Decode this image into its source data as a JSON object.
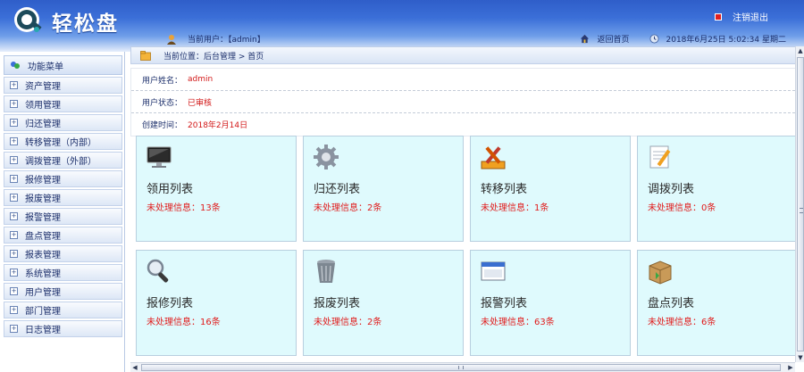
{
  "header": {
    "app_title": "轻松盘",
    "logout_label": "注销退出",
    "user_label": "当前用户：【admin】",
    "home_link": "返回首页",
    "datetime": "2018年6月25日  5:02:34 星期二"
  },
  "sidebar": {
    "title": "功能菜单",
    "items": [
      {
        "label": "资产管理"
      },
      {
        "label": "领用管理"
      },
      {
        "label": "归还管理"
      },
      {
        "label": "转移管理（内部）"
      },
      {
        "label": "调拨管理（外部）"
      },
      {
        "label": "报修管理"
      },
      {
        "label": "报废管理"
      },
      {
        "label": "报警管理"
      },
      {
        "label": "盘点管理"
      },
      {
        "label": "报表管理"
      },
      {
        "label": "系统管理"
      },
      {
        "label": "用户管理"
      },
      {
        "label": "部门管理"
      },
      {
        "label": "日志管理"
      }
    ]
  },
  "breadcrumb": {
    "text": "当前位置：后台管理 > 首页"
  },
  "info": {
    "name_label": "用户姓名：",
    "name_value": "admin",
    "status_label": "用户状态：",
    "status_value": "已审核",
    "time_label": "创建时间：",
    "time_value": "2018年2月14日"
  },
  "cards": [
    {
      "title": "领用列表",
      "stat": "未处理信息：13条",
      "icon": "monitor-icon"
    },
    {
      "title": "归还列表",
      "stat": "未处理信息：2条",
      "icon": "gear-icon"
    },
    {
      "title": "转移列表",
      "stat": "未处理信息：1条",
      "icon": "tools-icon"
    },
    {
      "title": "调拨列表",
      "stat": "未处理信息：0条",
      "icon": "notepad-icon"
    },
    {
      "title": "报修列表",
      "stat": "未处理信息：16条",
      "icon": "magnifier-icon"
    },
    {
      "title": "报废列表",
      "stat": "未处理信息：2条",
      "icon": "trash-icon"
    },
    {
      "title": "报警列表",
      "stat": "未处理信息：63条",
      "icon": "window-icon"
    },
    {
      "title": "盘点列表",
      "stat": "未处理信息：6条",
      "icon": "box-icon"
    }
  ],
  "colors": {
    "header_blue": "#3b6fd8",
    "card_bg": "#dffafd",
    "alert_red": "#e01b1b"
  }
}
